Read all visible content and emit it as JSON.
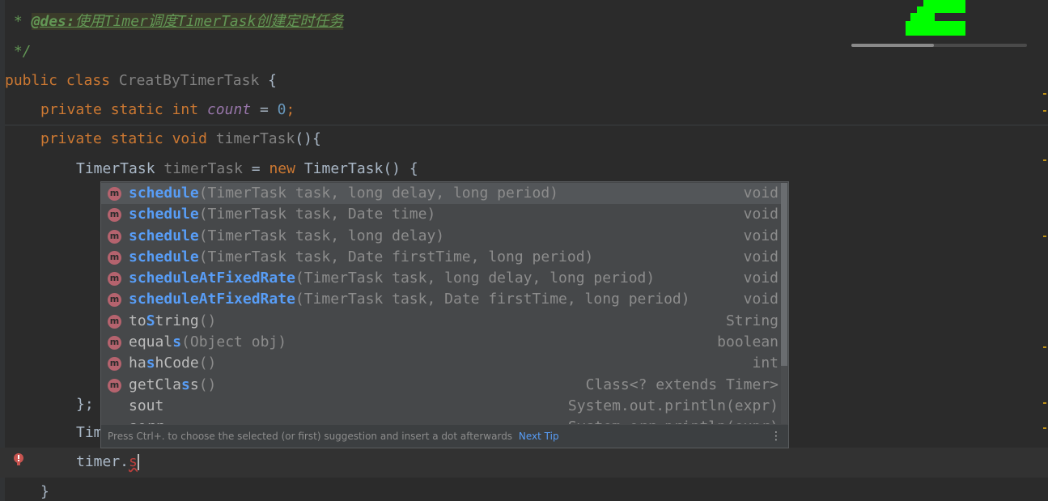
{
  "code": {
    "doc_star": " * ",
    "doc_tag": "@des:",
    "doc_text": "使用Timer调度TimerTask创建定时任务",
    "doc_end": " */",
    "l_public": "public",
    "l_class": "class",
    "l_classname": "CreatByTimerTask",
    "l_brace": " {",
    "l_private": "private",
    "l_static": "static",
    "l_int": "int",
    "l_count": "count",
    "l_eq": " = ",
    "l_zero": "0",
    "l_semi": ";",
    "l_void": "void",
    "l_method": "timerTask",
    "l_method_paren": "(){",
    "l_tt_type": "TimerTask",
    "l_tt_var": "timerTask",
    "l_new": "new",
    "l_tt_ctor": "TimerTask() {",
    "l_close_semi": "};",
    "l_tim": "Tim",
    "l_timer": "timer.",
    "l_s": "s",
    "l_close": "}"
  },
  "completion": {
    "items": [
      {
        "icon": "m",
        "match": "s",
        "rest": "chedule",
        "params": "(TimerTask task, long delay, long period)",
        "type": "void"
      },
      {
        "icon": "m",
        "match": "s",
        "rest": "chedule",
        "params": "(TimerTask task, Date time)",
        "type": "void"
      },
      {
        "icon": "m",
        "match": "s",
        "rest": "chedule",
        "params": "(TimerTask task, long delay)",
        "type": "void"
      },
      {
        "icon": "m",
        "match": "s",
        "rest": "chedule",
        "params": "(TimerTask task, Date firstTime, long period)",
        "type": "void"
      },
      {
        "icon": "m",
        "match": "s",
        "rest": "cheduleAtFixedRate",
        "params": "(TimerTask task, long delay, long period)",
        "type": "void"
      },
      {
        "icon": "m",
        "match": "s",
        "rest": "cheduleAtFixedRate",
        "params": "(TimerTask task, Date firstTime, long period)",
        "type": "void"
      },
      {
        "icon": "m",
        "pre": "to",
        "match": "S",
        "rest": "tring",
        "params": "()",
        "type": "String"
      },
      {
        "icon": "m",
        "pre": "equal",
        "match": "s",
        "rest": "",
        "params": "(Object obj)",
        "type": "boolean"
      },
      {
        "icon": "m",
        "pre": "ha",
        "match": "s",
        "rest": "hCode",
        "params": "()",
        "type": "int"
      },
      {
        "icon": "m",
        "pre": "getCla",
        "match": "s",
        "rest": "s",
        "params": "()",
        "type": "Class<? extends Timer>"
      },
      {
        "icon": "",
        "pre": "",
        "match": "",
        "rest": "sout",
        "params": "",
        "type": "System.out.println(expr)"
      },
      {
        "icon": "",
        "pre": "",
        "match": "",
        "rest": "serr",
        "params": "",
        "type": "System.err.println(expr)"
      }
    ],
    "footer": "Press Ctrl+. to choose the selected (or first) suggestion and insert a dot afterwards",
    "next_tip": "Next Tip",
    "more": "⋮"
  },
  "colors": {
    "background": "#2b2b2b",
    "keyword": "#cc7832",
    "method_match": "#589df6",
    "error_bulb": "#c75450",
    "minimap_green": "#00ff00"
  },
  "minimap": {
    "scroll_fraction": 0.47
  },
  "icons": [
    "error-bulb-icon",
    "method-icon",
    "more-options-icon"
  ]
}
